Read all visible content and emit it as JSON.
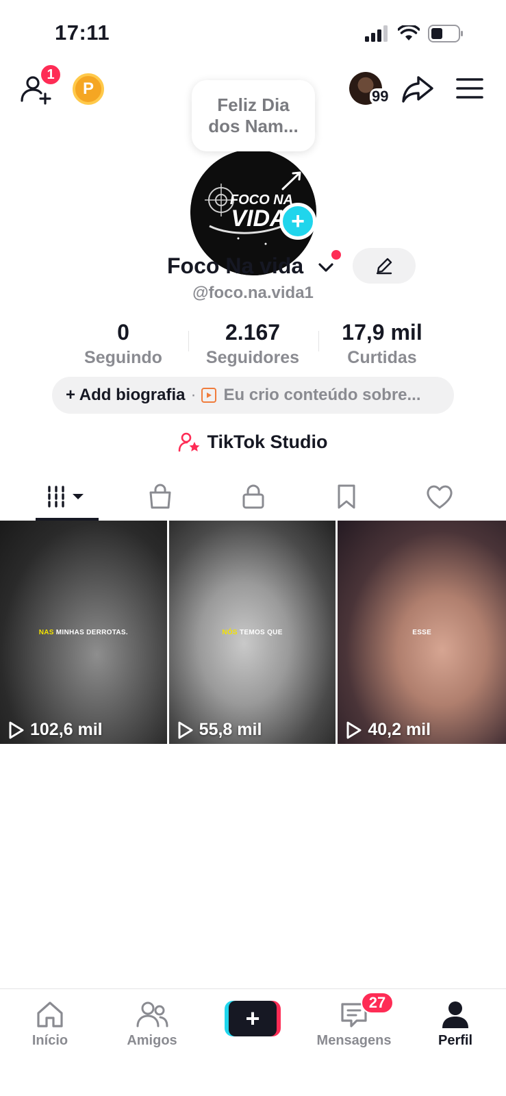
{
  "status_bar": {
    "time": "17:11"
  },
  "header": {
    "notification_count": "1",
    "coin_label": "P",
    "story_count": "99"
  },
  "profile": {
    "note": "Feliz Dia dos Nam...",
    "avatar_logo_line1": "FOCO NA",
    "avatar_logo_line2": "VIDA",
    "name": "Foco Na vida",
    "handle": "@foco.na.vida1"
  },
  "stats": [
    {
      "value": "0",
      "label": "Seguindo"
    },
    {
      "value": "2.167",
      "label": "Seguidores"
    },
    {
      "value": "17,9 mil",
      "label": "Curtidas"
    }
  ],
  "bio": {
    "add_label": "+ Add biografia",
    "separator": "·",
    "suggestion": "Eu crio conteúdo sobre..."
  },
  "studio": {
    "label": "TikTok Studio"
  },
  "tabs": [
    "videos",
    "shop",
    "private",
    "saved",
    "liked"
  ],
  "videos": [
    {
      "caption_highlight": "NAS",
      "caption_rest": " MINHAS DERROTAS.",
      "views": "102,6 mil"
    },
    {
      "caption_highlight": "NÓS",
      "caption_rest": " TEMOS QUE",
      "views": "55,8 mil"
    },
    {
      "caption_highlight": "",
      "caption_rest": "ESSE",
      "views": "40,2 mil"
    }
  ],
  "bottom_nav": {
    "home": "Início",
    "friends": "Amigos",
    "messages": "Mensagens",
    "messages_badge": "27",
    "profile": "Perfil"
  },
  "colors": {
    "accent_red": "#fe2c55",
    "accent_cyan": "#20d5ec",
    "text_primary": "#161823",
    "text_secondary": "#8a8b91"
  }
}
